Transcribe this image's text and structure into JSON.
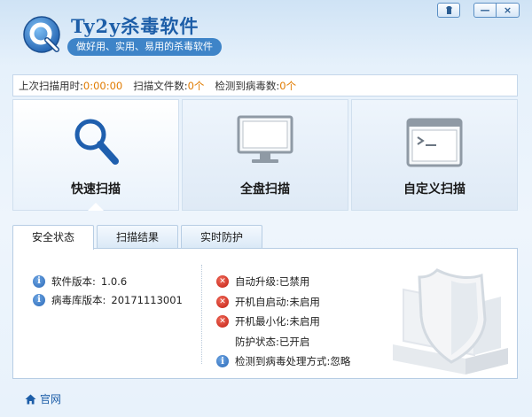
{
  "header": {
    "title": "Ty2y杀毒软件",
    "subtitle": "做好用、实用、易用的杀毒软件",
    "logo_icon": "app-logo-icon"
  },
  "window_controls": {
    "skin_icon": "skin-icon",
    "minimize_label": "—",
    "close_label": "×"
  },
  "status_bar": {
    "last_scan_time_label": "上次扫描用时:",
    "last_scan_time_value": "0:00:00",
    "scanned_files_label": "扫描文件数:",
    "scanned_files_value": "0个",
    "viruses_found_label": "检测到病毒数:",
    "viruses_found_value": "0个"
  },
  "scan_tiles": [
    {
      "label": "快速扫描",
      "icon": "magnifier-icon",
      "active": true
    },
    {
      "label": "全盘扫描",
      "icon": "monitor-icon",
      "active": false
    },
    {
      "label": "自定义扫描",
      "icon": "terminal-icon",
      "active": false
    }
  ],
  "tabs": [
    {
      "label": "安全状态",
      "active": true
    },
    {
      "label": "扫描结果",
      "active": false
    },
    {
      "label": "实时防护",
      "active": false
    }
  ],
  "info": {
    "software_version_label": "软件版本:",
    "software_version_value": "1.0.6",
    "virus_db_version_label": "病毒库版本:",
    "virus_db_version_value": "20171113001"
  },
  "security_status": [
    {
      "icon": "error-icon",
      "text": "自动升级:已禁用"
    },
    {
      "icon": "error-icon",
      "text": "开机自启动:未启用"
    },
    {
      "icon": "error-icon",
      "text": "开机最小化:未启用"
    },
    {
      "icon": "",
      "text": "防护状态:已开启"
    },
    {
      "icon": "info-icon",
      "text": "检测到病毒处理方式:忽略"
    }
  ],
  "footer": {
    "home_label": "官网",
    "home_icon": "home-icon"
  },
  "colors": {
    "accent": "#1d5ea8",
    "value_orange": "#e07b00",
    "error_red": "#c21f12",
    "info_blue": "#2a68b7"
  }
}
